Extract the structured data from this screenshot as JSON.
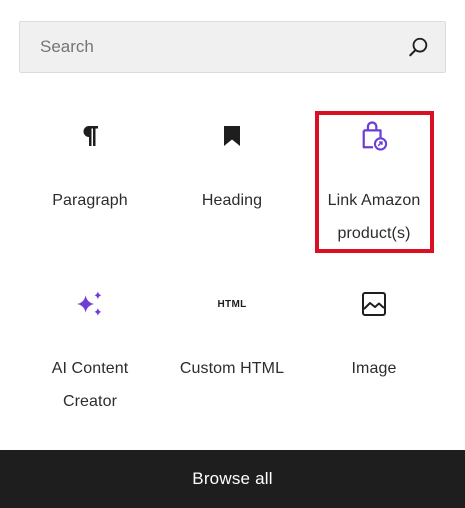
{
  "search": {
    "placeholder": "Search",
    "value": "",
    "icon": "search-icon"
  },
  "blocks": [
    {
      "label": "Paragraph",
      "icon": "paragraph-icon"
    },
    {
      "label": "Heading",
      "icon": "bookmark-icon"
    },
    {
      "label": "Link Amazon product(s)",
      "label_line1": "Link Amazon",
      "label_line2": "product(s)",
      "icon": "shopping-bag-icon",
      "highlighted": true,
      "icon_color": "#6b3fd4"
    },
    {
      "label": "AI Content Creator",
      "label_line1": "AI Content",
      "label_line2": "Creator",
      "icon": "sparkles-icon",
      "icon_color": "#6b3fd4"
    },
    {
      "label": "Custom HTML",
      "icon": "html-icon",
      "glyph": "HTML"
    },
    {
      "label": "Image",
      "icon": "image-icon"
    }
  ],
  "footer": {
    "browse_all_label": "Browse all"
  },
  "colors": {
    "highlight": "#d90f22",
    "accent": "#6b3fd4",
    "footer_bg": "#1e1e1e"
  }
}
